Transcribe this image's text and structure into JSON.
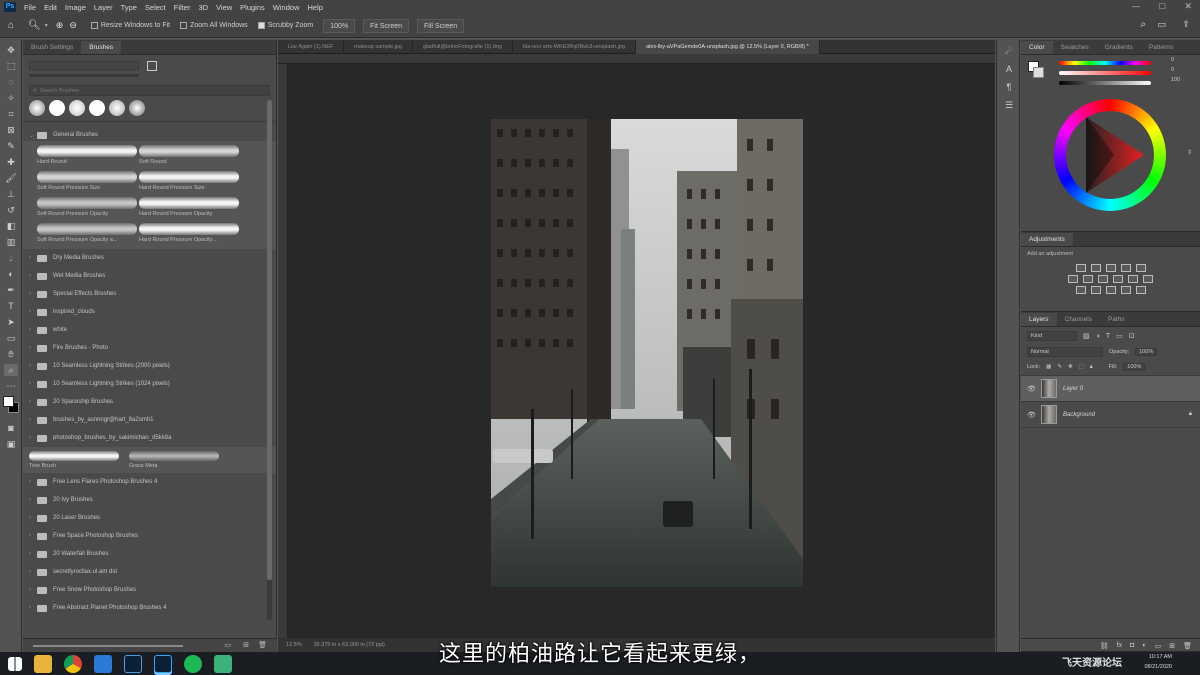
{
  "app": {
    "logo": "Ps"
  },
  "menu": [
    "File",
    "Edit",
    "Image",
    "Layer",
    "Type",
    "Select",
    "Filter",
    "3D",
    "View",
    "Plugins",
    "Window",
    "Help"
  ],
  "options": {
    "resize_windows": "Resize Windows to Fit",
    "zoom_all": "Zoom All Windows",
    "scrubby": "Scrubby Zoom",
    "zoom_pct": "100%",
    "fit_screen": "Fit Screen",
    "fill_screen": "Fill Screen"
  },
  "left_panel": {
    "tabs": [
      "Brush Settings",
      "Brushes"
    ],
    "search_placeholder": "Search Brushes",
    "general_folder": "General Brushes",
    "general_brushes": [
      "Hard Round",
      "Soft Round",
      "Soft Round Pressure Size",
      "Hard Round Pressure Size",
      "Soft Round Pressure Opacity",
      "Hard Round Pressure Opacity",
      "Soft Round Pressure Opacity a...",
      "Hard Round Pressure Opacity..."
    ],
    "folders_a": [
      "Dry Media Brushes",
      "Wet Media Brushes",
      "Special Effects Brushes",
      "inspired_clouds",
      "white",
      "Fire Brushes - Photo",
      "10 Seamless Lightning Strikes (2000 pixels)",
      "10 Seamless Lightning Strikes (1024 pixels)",
      "20 Spaceship Brushes",
      "brushes_by_asnnngr@hart_8a2smh1",
      "photoshop_brushes_by_sakimichan_d5kk8a"
    ],
    "loose_brushes": [
      "Tree Brush",
      "Grass Meta"
    ],
    "folders_b": [
      "Free Lens Flares Photoshop Brushes 4",
      "20 Ivy Brushes",
      "20 Laser Brushes",
      "Free Space Photoshop Brushes",
      "20 Waterfall Brushes",
      "secretlyrocllax.ul.am dst",
      "Free Snow Photoshop Brushes",
      "Free Abstract Planet Photoshop Brushes 4"
    ]
  },
  "doc_tabs": [
    "Liar Again (1).NEF",
    "makeup sample.jpg",
    "gladfull@bohoFotografie (1).dng",
    "bla-ooo arts-WKE0Rq0BwUl-unsplash.jpg",
    "alex-lby-aVPaGemde0A-unsplash.jpg @ 12.5% (Layer 0, RGB/8) *"
  ],
  "status": {
    "zoom": "12.5%",
    "dims": "35.375 in x 63.000 in (72 ppi)"
  },
  "right_panel": {
    "color_tabs": [
      "Color",
      "Swatches",
      "Gradients",
      "Patterns"
    ],
    "slider_vals": [
      "0",
      "0",
      "100"
    ],
    "adjustments": {
      "title": "Adjustments",
      "subtitle": "Add an adjustment"
    },
    "layers_tabs": [
      "Layers",
      "Channels",
      "Paths"
    ],
    "kind": "Kind",
    "blend_mode": "Normal",
    "opacity_label": "Opacity:",
    "opacity": "100%",
    "lock_label": "Lock:",
    "fill_label": "Fill:",
    "fill": "100%",
    "layers": [
      "Layer 0",
      "Background"
    ]
  },
  "subtitle": "这里的柏油路让它看起来更绿，",
  "watermark": "飞天资源论坛",
  "tray": {
    "time": "10:17 AM",
    "date": "08/21/2020"
  },
  "colors": {
    "accent": "#31a8ff",
    "doc_bg": "#282828",
    "panel": "#4a4a4a"
  }
}
